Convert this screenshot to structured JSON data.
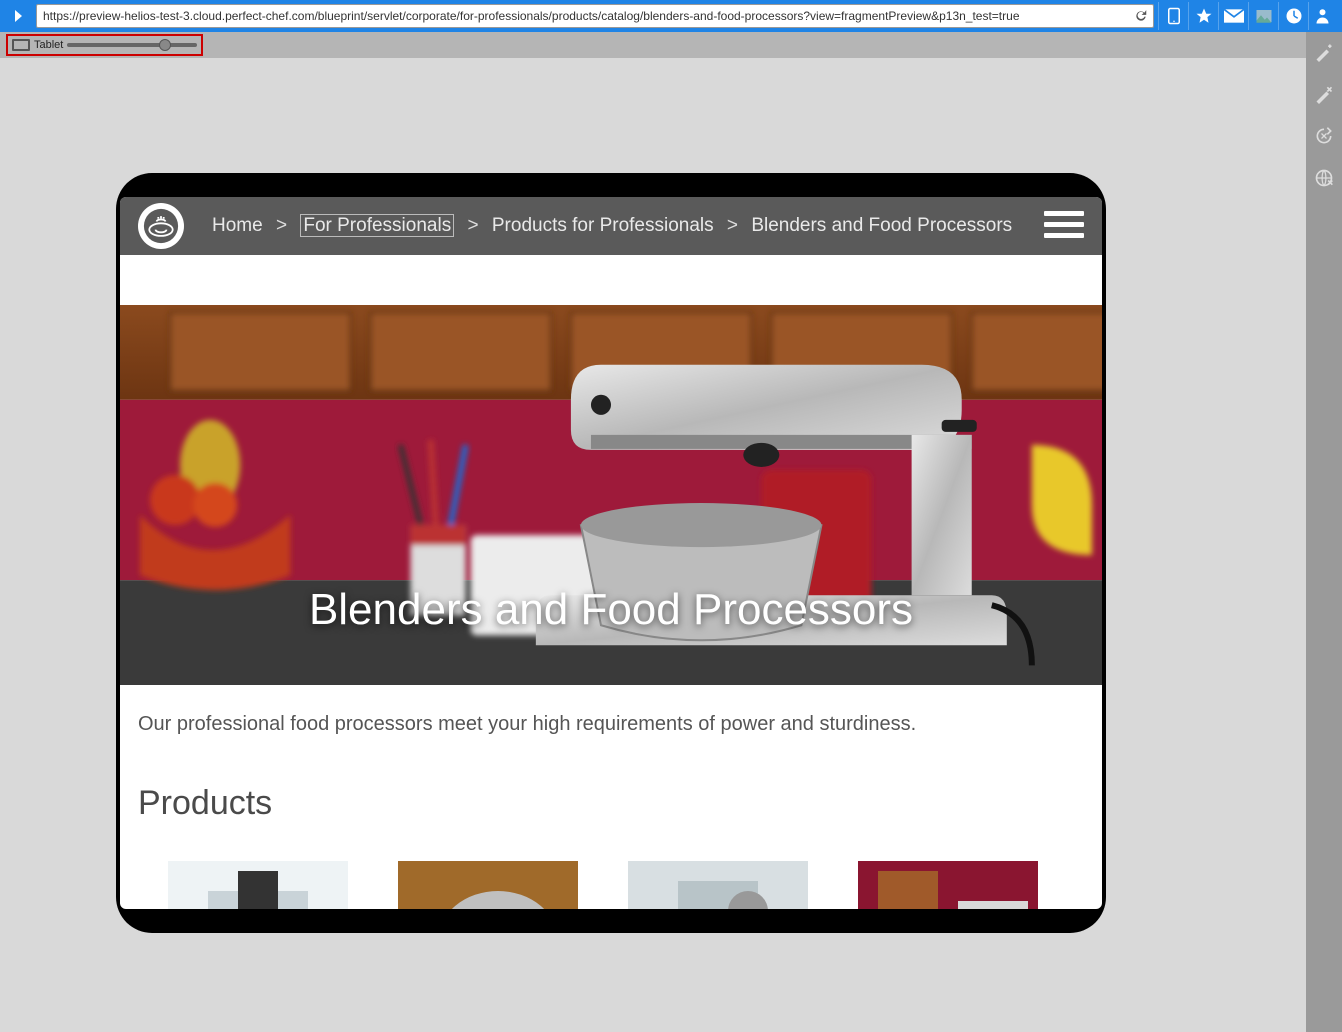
{
  "toolbar": {
    "url": "https://preview-helios-test-3.cloud.perfect-chef.com/blueprint/servlet/corporate/for-professionals/products/catalog/blenders-and-food-processors?view=fragmentPreview&p13n_test=true"
  },
  "device_bar": {
    "device_label": "Tablet"
  },
  "site": {
    "breadcrumb": {
      "home": "Home",
      "professionals": "For Professionals",
      "products": "Products for Professionals",
      "current": "Blenders and Food Processors"
    },
    "hero_title": "Blenders and Food Processors",
    "lead": "Our professional food processors meet your high requirements of power and sturdiness.",
    "section_title": "Products"
  }
}
